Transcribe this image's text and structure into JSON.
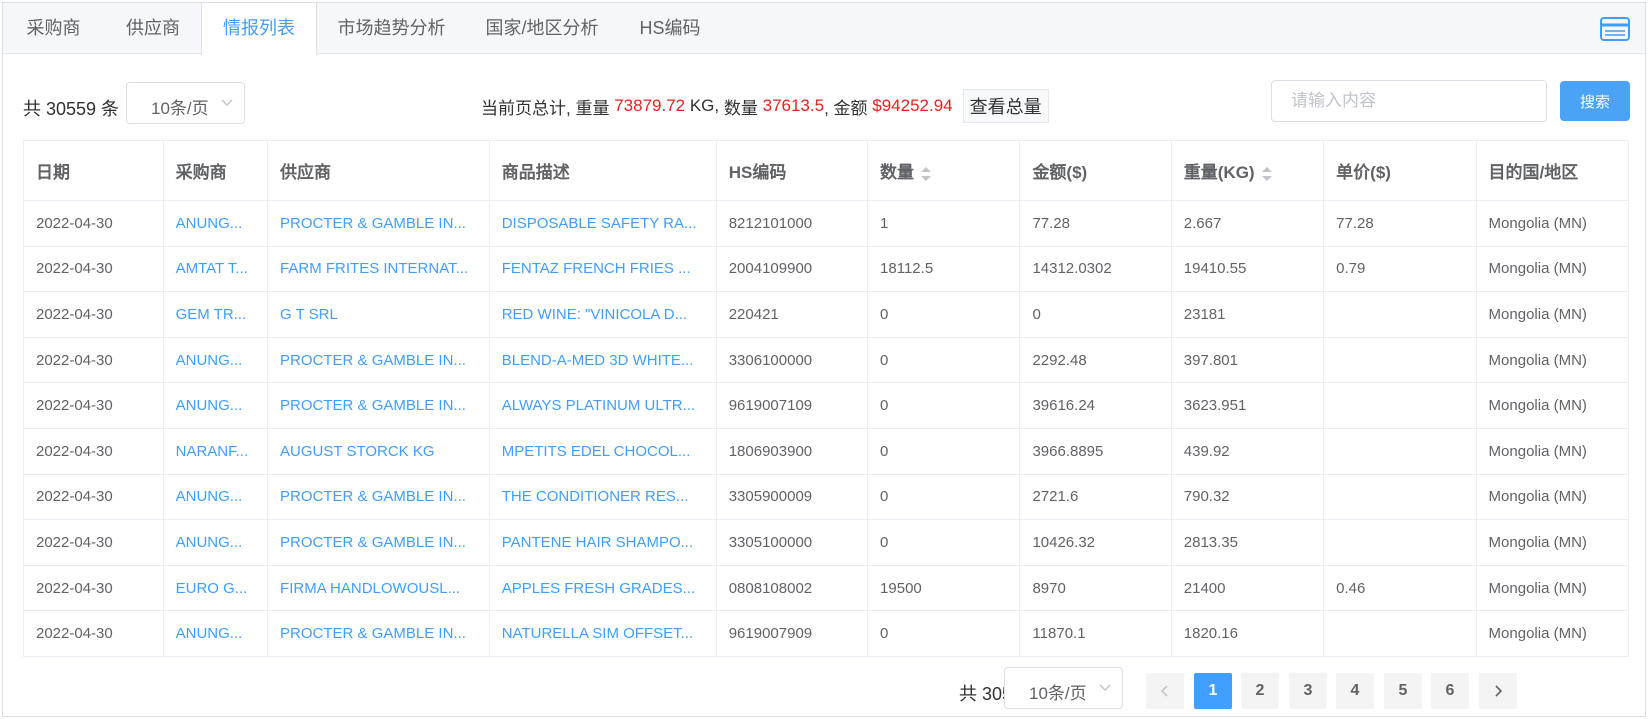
{
  "tabs": [
    {
      "label": "采购商",
      "active": false
    },
    {
      "label": "供应商",
      "active": false
    },
    {
      "label": "情报列表",
      "active": true
    },
    {
      "label": "市场趋势分析",
      "active": false
    },
    {
      "label": "国家/地区分析",
      "active": false
    },
    {
      "label": "HS编码",
      "active": false
    }
  ],
  "toolbar": {
    "total_text": "共 30559 条",
    "page_size": "10条/页",
    "summary": {
      "prefix": "当前页总计,",
      "weight_label": "重量",
      "weight_value": "73879.72",
      "weight_unit": "KG,",
      "qty_label": "数量",
      "qty_value": "37613.5",
      "amount_label": ", 金额",
      "amount_value": "$94252.94"
    },
    "view_total_label": "查看总量",
    "search_placeholder": "请输入内容",
    "search_label": "搜索"
  },
  "table": {
    "columns": [
      "日期",
      "采购商",
      "供应商",
      "商品描述",
      "HS编码",
      "数量",
      "金额($)",
      "重量(KG)",
      "单价($)",
      "目的国/地区"
    ],
    "sortable": [
      "数量",
      "重量(KG)"
    ],
    "rows": [
      [
        "2022-04-30",
        "ANUNG...",
        "PROCTER & GAMBLE IN...",
        "DISPOSABLE SAFETY RA...",
        "8212101000",
        "1",
        "77.28",
        "2.667",
        "77.28",
        "Mongolia (MN)"
      ],
      [
        "2022-04-30",
        "AMTAT T...",
        "FARM FRITES INTERNAT...",
        "FENTAZ FRENCH FRIES ...",
        "2004109900",
        "18112.5",
        "14312.0302",
        "19410.55",
        "0.79",
        "Mongolia (MN)"
      ],
      [
        "2022-04-30",
        "GEM TR...",
        "G T SRL",
        "RED WINE: \"VINICOLA D...",
        "220421",
        "0",
        "0",
        "23181",
        "",
        "Mongolia (MN)"
      ],
      [
        "2022-04-30",
        "ANUNG...",
        "PROCTER & GAMBLE IN...",
        "BLEND-A-MED 3D WHITE...",
        "3306100000",
        "0",
        "2292.48",
        "397.801",
        "",
        "Mongolia (MN)"
      ],
      [
        "2022-04-30",
        "ANUNG...",
        "PROCTER & GAMBLE IN...",
        "ALWAYS PLATINUM ULTR...",
        "9619007109",
        "0",
        "39616.24",
        "3623.951",
        "",
        "Mongolia (MN)"
      ],
      [
        "2022-04-30",
        "NARANF...",
        "AUGUST STORCK KG",
        "MPETITS EDEL CHOCOL...",
        "1806903900",
        "0",
        "3966.8895",
        "439.92",
        "",
        "Mongolia (MN)"
      ],
      [
        "2022-04-30",
        "ANUNG...",
        "PROCTER & GAMBLE IN...",
        "THE CONDITIONER RES...",
        "3305900009",
        "0",
        "2721.6",
        "790.32",
        "",
        "Mongolia (MN)"
      ],
      [
        "2022-04-30",
        "ANUNG...",
        "PROCTER & GAMBLE IN...",
        "PANTENE HAIR SHAMPO...",
        "3305100000",
        "0",
        "10426.32",
        "2813.35",
        "",
        "Mongolia (MN)"
      ],
      [
        "2022-04-30",
        "EURO G...",
        "FIRMA HANDLOWOUSL...",
        "APPLES FRESH GRADES...",
        "0808108002",
        "19500",
        "8970",
        "21400",
        "0.46",
        "Mongolia (MN)"
      ],
      [
        "2022-04-30",
        "ANUNG...",
        "PROCTER & GAMBLE IN...",
        "NATURELLA SIM OFFSET...",
        "9619007909",
        "0",
        "11870.1",
        "1820.16",
        "",
        "Mongolia (MN)"
      ]
    ]
  },
  "pagination": {
    "total_text": "共 30559 条",
    "page_size": "10条/页",
    "pages": [
      "1",
      "2",
      "3",
      "4",
      "5",
      "6"
    ],
    "current": "1"
  },
  "colors": {
    "accent": "#409eff",
    "highlight": "#f01f1f"
  }
}
